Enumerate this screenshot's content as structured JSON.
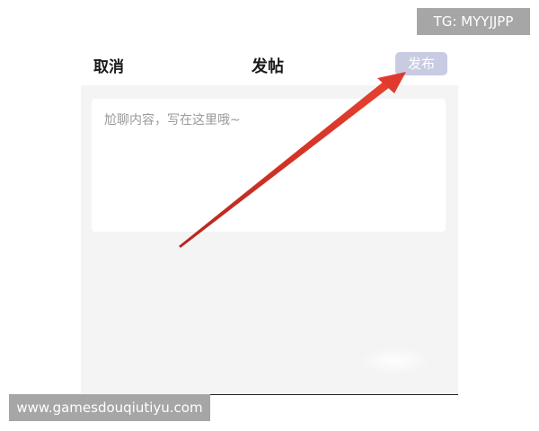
{
  "header": {
    "cancel_label": "取消",
    "title": "发帖",
    "publish_label": "发布"
  },
  "editor": {
    "placeholder": "尬聊内容，写在这里哦~"
  },
  "watermarks": {
    "tg": "TG: MYYJJPP",
    "site": "www.gamesdouqiutiyu.com"
  },
  "colors": {
    "publish_button_bg": "#c9cbe3",
    "body_bg": "#f4f4f4",
    "arrow": "#e03a2f",
    "watermark_bg": "#a6a6a6"
  },
  "annotation": {
    "icon": "red-arrow-icon"
  }
}
